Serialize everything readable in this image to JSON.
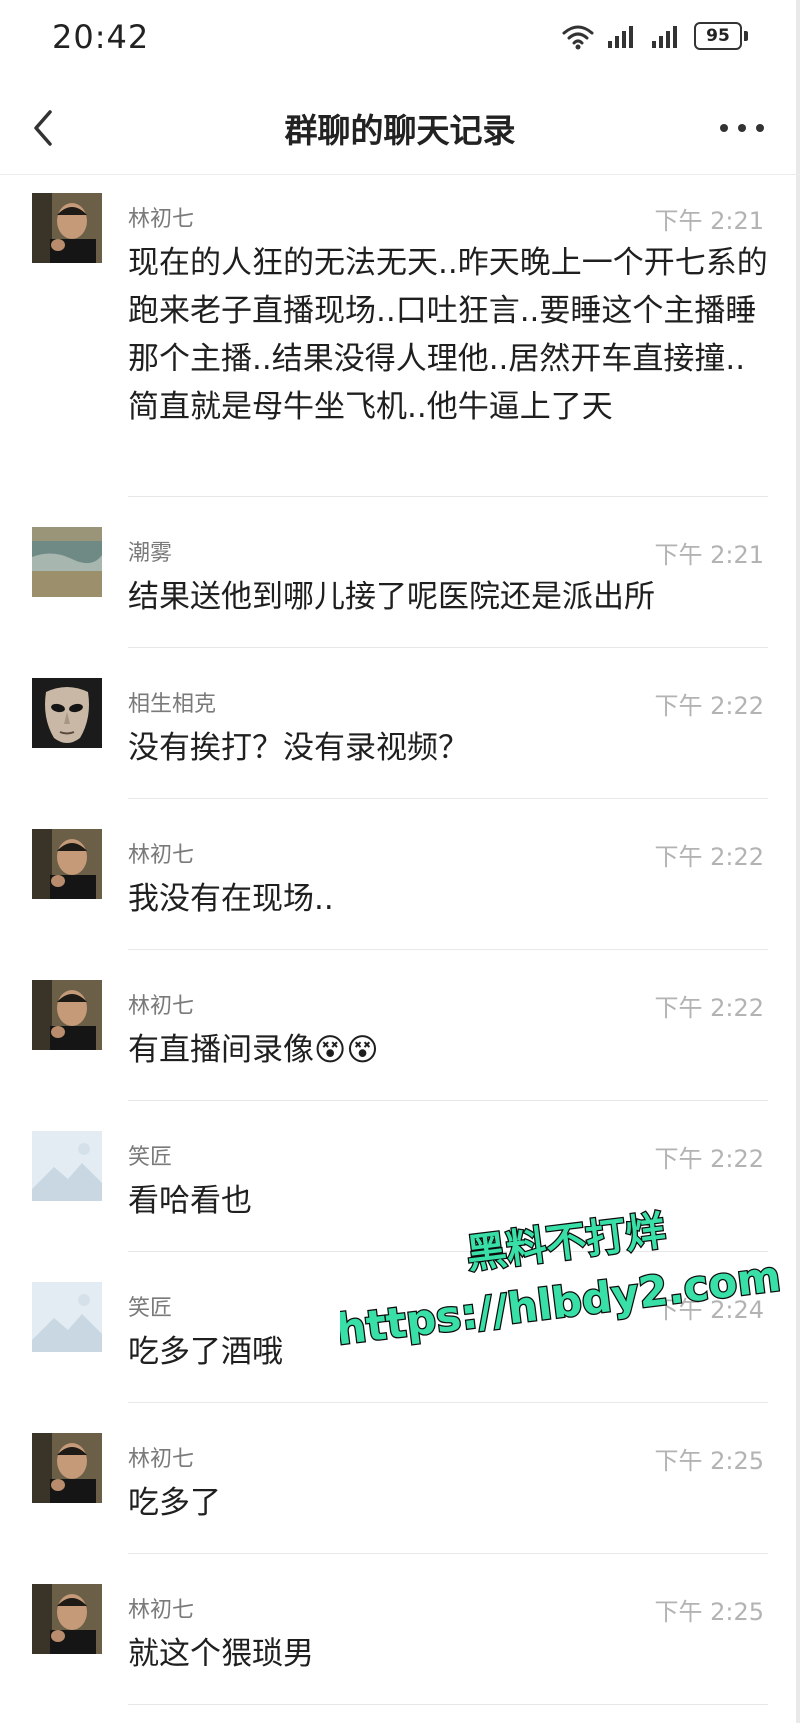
{
  "status": {
    "time": "20:42",
    "battery": "95"
  },
  "header": {
    "title": "群聊的聊天记录"
  },
  "watermark": {
    "line1": "黑料不打烊",
    "line2": "https://hlbdy2.com"
  },
  "messages": [
    {
      "name": "林初七",
      "time": "下午 2:21",
      "avatar": "man-avatar",
      "text": "现在的人狂的无法无天..昨天晚上一个开七系的跑来老子直播现场..口吐狂言..要睡这个主播睡那个主播..结果没得人理他..居然开车直接撞..简直就是母牛坐飞机..他牛逼上了天"
    },
    {
      "name": "潮雾",
      "time": "下午 2:21",
      "avatar": "landscape-avatar",
      "text": "结果送他到哪儿接了呢医院还是派出所"
    },
    {
      "name": "相生相克",
      "time": "下午 2:22",
      "avatar": "mask-avatar",
      "text": "没有挨打？没有录视频？"
    },
    {
      "name": "林初七",
      "time": "下午 2:22",
      "avatar": "man-avatar",
      "text": "我没有在现场.."
    },
    {
      "name": "林初七",
      "time": "下午 2:22",
      "avatar": "man-avatar",
      "text": "有直播间录像",
      "emoji": "😵😵"
    },
    {
      "name": "笑匠",
      "time": "下午 2:22",
      "avatar": "placeholder-avatar",
      "text": "看哈看也"
    },
    {
      "name": "笑匠",
      "time": "下午 2:24",
      "avatar": "placeholder-avatar",
      "text": "吃多了酒哦"
    },
    {
      "name": "林初七",
      "time": "下午 2:25",
      "avatar": "man-avatar",
      "text": "吃多了"
    },
    {
      "name": "林初七",
      "time": "下午 2:25",
      "avatar": "man-avatar",
      "text": "就这个猥琐男"
    }
  ]
}
